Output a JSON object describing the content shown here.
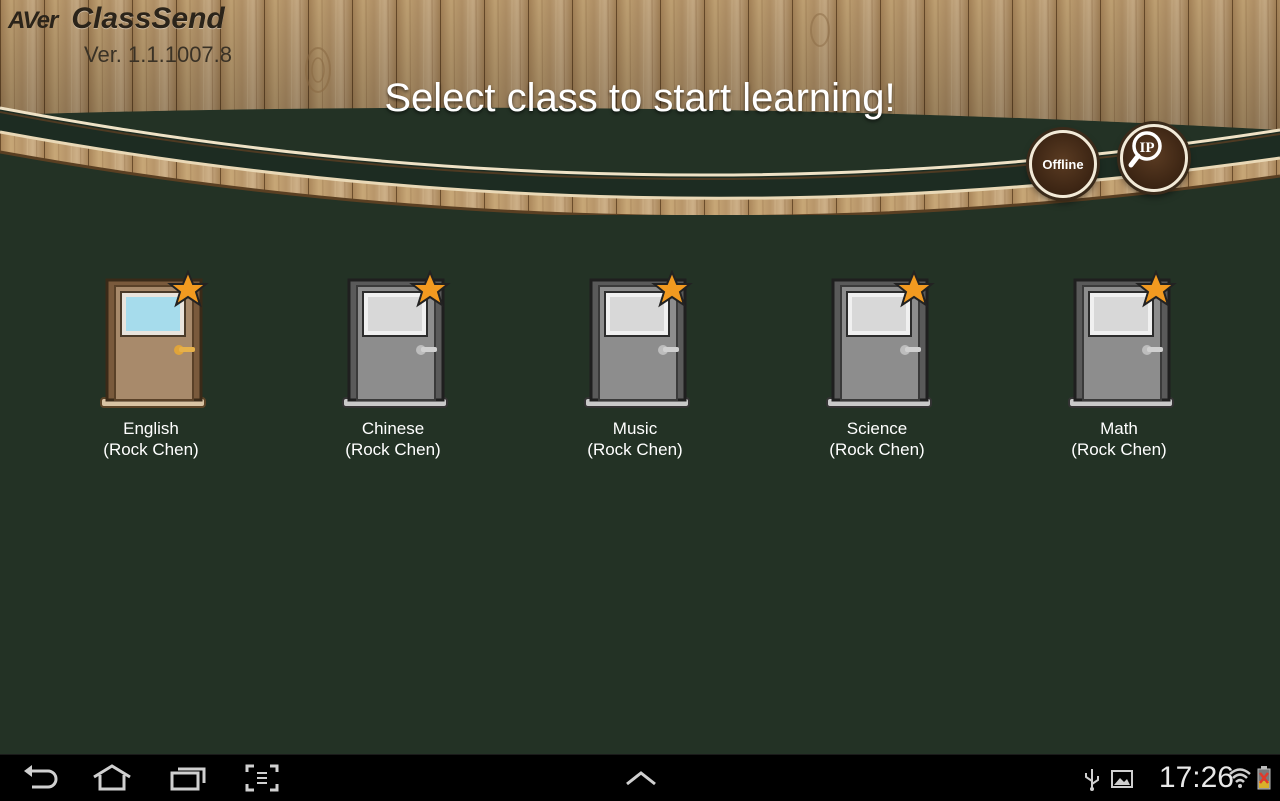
{
  "app": {
    "brand": "AVer",
    "name": "ClassSend",
    "version": "Ver. 1.1.1007.8"
  },
  "headline": "Select class to start learning!",
  "header_buttons": {
    "offline_label": "Offline",
    "ip_label": "IP"
  },
  "classes": [
    {
      "name": "English",
      "owner": "(Rock Chen)",
      "style": "wood",
      "starred": true
    },
    {
      "name": "Chinese",
      "owner": "(Rock Chen)",
      "style": "gray",
      "starred": true
    },
    {
      "name": "Music",
      "owner": "(Rock Chen)",
      "style": "gray",
      "starred": true
    },
    {
      "name": "Science",
      "owner": "(Rock Chen)",
      "style": "gray",
      "starred": true
    },
    {
      "name": "Math",
      "owner": "(Rock Chen)",
      "style": "gray",
      "starred": true
    }
  ],
  "system_bar": {
    "clock": "17:26",
    "nav_icons": [
      "back-icon",
      "home-icon",
      "recent-apps-icon",
      "screenshot-icon",
      "up-arrow-icon"
    ],
    "status_icons": [
      "usb-icon",
      "gallery-icon",
      "wifi-icon",
      "battery-icon"
    ]
  },
  "colors": {
    "background": "#233225",
    "wood": "#b89464",
    "header_text": "#ffffff"
  }
}
